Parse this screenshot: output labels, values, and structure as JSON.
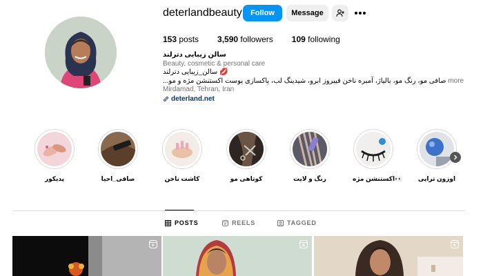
{
  "profile": {
    "username": "deterlandbeauty",
    "follow_label": "Follow",
    "message_label": "Message",
    "add_user_icon": "add-user-icon",
    "more_icon": "more-options-icon",
    "posts_count": "153",
    "posts_label": " posts",
    "followers_count": "3,590",
    "followers_label": " followers",
    "following_count": "109",
    "following_label": " following",
    "display_name": "سالن زیبایی دترلند",
    "category": "Beauty, cosmetic & personal care",
    "bio_line1": "سالن_زیبایی دترلند 💋",
    "bio_line2": "...صافی مو، رنگ مو، بالیاژ، آمبره ناخن فیبروز ابرو، شیدینگ لب، پاکسازی پوست اکستنشن مژه و مو",
    "more_label": "more",
    "location": "Mirdamad, Tehran, Iran",
    "website": "deterland.net"
  },
  "highlights": [
    {
      "label": "پدیکور"
    },
    {
      "label": "صافی_احیا"
    },
    {
      "label": "کاشت ناخن"
    },
    {
      "label": "کوتاهی مو"
    },
    {
      "label": "رنگ و لایت"
    },
    {
      "label": "اکستنشن مژه👀"
    },
    {
      "label": "اوزون تراپی"
    }
  ],
  "tabs": [
    {
      "label": "POSTS",
      "active": true
    },
    {
      "label": "REELS",
      "active": false
    },
    {
      "label": "TAGGED",
      "active": false
    }
  ],
  "colors": {
    "accent": "#0095f6",
    "link": "#00376b",
    "muted": "#737373",
    "divider": "#dbdbdb"
  }
}
